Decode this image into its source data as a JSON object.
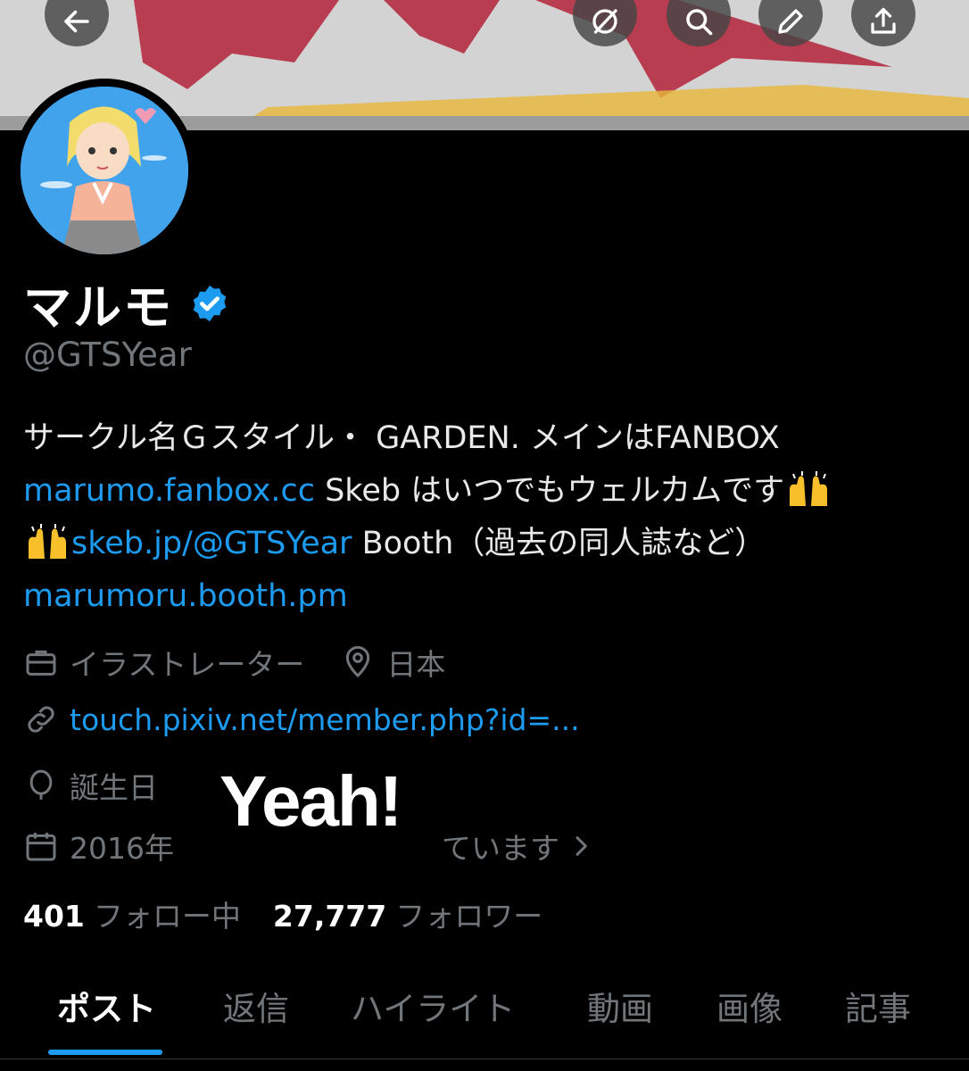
{
  "header": {
    "back_icon": "arrow-left-icon",
    "actions": [
      "grok-icon",
      "search-icon",
      "edit-icon",
      "share-icon"
    ]
  },
  "profile": {
    "display_name": "マルモ",
    "handle": "@GTSYear",
    "bio_line1": "サークル名Ｇスタイル・ GARDEN. メインはFANBOX",
    "bio_link1": "marumo.fanbox.cc",
    "bio_text2": " Skeb はいつでもウェルカムです",
    "bio_link2": "skeb.jp/@GTSYear",
    "bio_text3": " Booth（過去の同人誌など）",
    "bio_link3": "marumoru.booth.pm",
    "profession": "イラストレーター",
    "location": "日本",
    "website": "touch.pixiv.net/member.php?id=...",
    "birthday": "誕生日",
    "joined_prefix": "2016年",
    "joined_suffix": "ています",
    "following_count": "401",
    "following_label": "フォロー中",
    "followers_count": "27,777",
    "followers_label": "フォロワー"
  },
  "overlay_text": "Yeah!",
  "tabs": [
    {
      "label": "ポスト",
      "active": true
    },
    {
      "label": "返信",
      "active": false
    },
    {
      "label": "ハイライト",
      "active": false
    },
    {
      "label": "動画",
      "active": false
    },
    {
      "label": "画像",
      "active": false
    },
    {
      "label": "記事",
      "active": false
    }
  ],
  "colors": {
    "link": "#1d9bf0",
    "muted": "#71767b",
    "verified": "#1d9bf0",
    "background": "#000000"
  }
}
